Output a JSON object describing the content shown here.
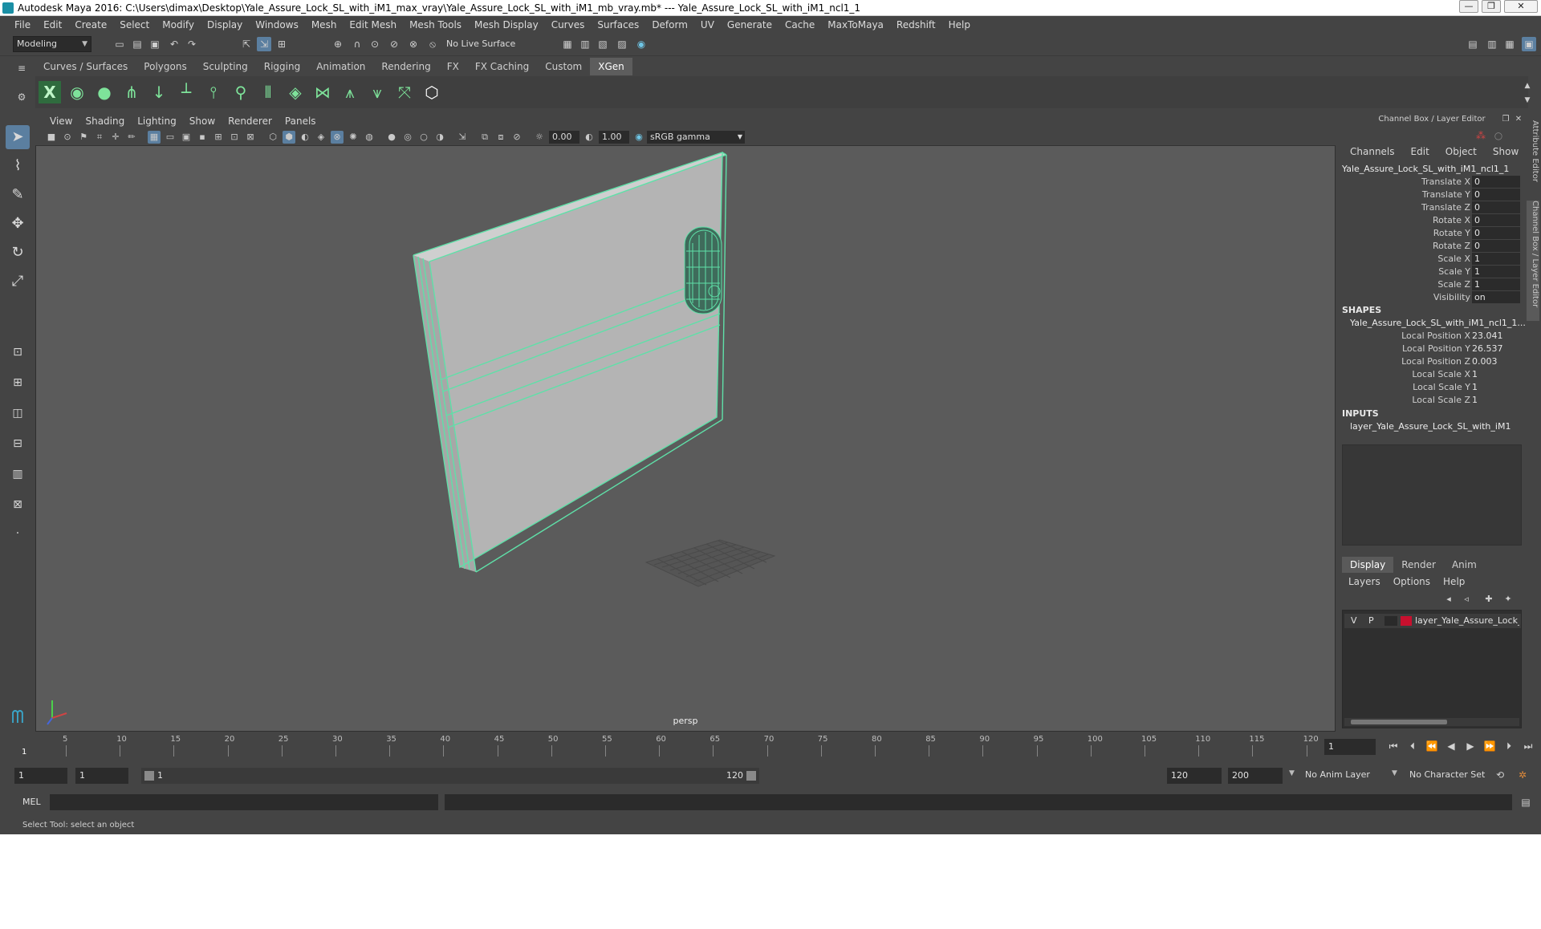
{
  "titlebar": {
    "title": "Autodesk Maya 2016: C:\\Users\\dimax\\Desktop\\Yale_Assure_Lock_SL_with_iM1_max_vray\\Yale_Assure_Lock_SL_with_iM1_mb_vray.mb*   ---   Yale_Assure_Lock_SL_with_iM1_ncl1_1",
    "minimize": "—",
    "maximize": "❐",
    "close": "✕"
  },
  "menubar": [
    "File",
    "Edit",
    "Create",
    "Select",
    "Modify",
    "Display",
    "Windows",
    "Mesh",
    "Edit Mesh",
    "Mesh Tools",
    "Mesh Display",
    "Curves",
    "Surfaces",
    "Deform",
    "UV",
    "Generate",
    "Cache",
    "MaxToMaya",
    "Redshift",
    "Help"
  ],
  "statusline": {
    "mode": "Modeling",
    "live_surface": "No Live Surface"
  },
  "shelf_tabs": [
    {
      "label": "Curves / Surfaces",
      "active": false
    },
    {
      "label": "Polygons",
      "active": false
    },
    {
      "label": "Sculpting",
      "active": false
    },
    {
      "label": "Rigging",
      "active": false
    },
    {
      "label": "Animation",
      "active": false
    },
    {
      "label": "Rendering",
      "active": false
    },
    {
      "label": "FX",
      "active": false
    },
    {
      "label": "FX Caching",
      "active": false
    },
    {
      "label": "Custom",
      "active": false
    },
    {
      "label": "XGen",
      "active": true
    }
  ],
  "panel_menu": [
    "View",
    "Shading",
    "Lighting",
    "Show",
    "Renderer",
    "Panels"
  ],
  "panel_tools": {
    "exposure": "0.00",
    "gamma": "1.00",
    "color_space": "sRGB gamma"
  },
  "viewport": {
    "camera_label": "persp"
  },
  "channel_box": {
    "panel_title": "Channel Box / Layer Editor",
    "menus": [
      "Channels",
      "Edit",
      "Object",
      "Show"
    ],
    "object_name": "Yale_Assure_Lock_SL_with_iM1_ncl1_1",
    "attributes": [
      {
        "name": "Translate X",
        "value": "0"
      },
      {
        "name": "Translate Y",
        "value": "0"
      },
      {
        "name": "Translate Z",
        "value": "0"
      },
      {
        "name": "Rotate X",
        "value": "0"
      },
      {
        "name": "Rotate Y",
        "value": "0"
      },
      {
        "name": "Rotate Z",
        "value": "0"
      },
      {
        "name": "Scale X",
        "value": "1"
      },
      {
        "name": "Scale Y",
        "value": "1"
      },
      {
        "name": "Scale Z",
        "value": "1"
      },
      {
        "name": "Visibility",
        "value": "on"
      }
    ],
    "shapes_header": "SHAPES",
    "shape_name": "Yale_Assure_Lock_SL_with_iM1_ncl1_1...",
    "shape_attributes": [
      {
        "name": "Local Position X",
        "value": "23.041"
      },
      {
        "name": "Local Position Y",
        "value": "26.537"
      },
      {
        "name": "Local Position Z",
        "value": "0.003"
      },
      {
        "name": "Local Scale X",
        "value": "1"
      },
      {
        "name": "Local Scale Y",
        "value": "1"
      },
      {
        "name": "Local Scale Z",
        "value": "1"
      }
    ],
    "inputs_header": "INPUTS",
    "input_name": "layer_Yale_Assure_Lock_SL_with_iM1"
  },
  "side_tabs": {
    "attribute_editor": "Attribute Editor",
    "channel_box": "Channel Box / Layer Editor"
  },
  "layer_editor": {
    "tabs": [
      {
        "label": "Display",
        "active": true
      },
      {
        "label": "Render",
        "active": false
      },
      {
        "label": "Anim",
        "active": false
      }
    ],
    "menus": [
      "Layers",
      "Options",
      "Help"
    ],
    "layer": {
      "v": "V",
      "p": "P",
      "name": "layer_Yale_Assure_Lock_S",
      "color": "#c8102e"
    }
  },
  "timeline": {
    "ticks": [
      "5",
      "10",
      "15",
      "20",
      "25",
      "30",
      "35",
      "40",
      "45",
      "50",
      "55",
      "60",
      "65",
      "70",
      "75",
      "80",
      "85",
      "90",
      "95",
      "100",
      "105",
      "110",
      "115",
      "120"
    ],
    "start_marker": "1",
    "current_frame": "1"
  },
  "range": {
    "start": "1",
    "anim_start": "1",
    "slider_start": "1",
    "slider_end": "120",
    "end": "120",
    "anim_end": "200",
    "anim_layer": "No Anim Layer",
    "character_set": "No Character Set"
  },
  "commandline": {
    "lang": "MEL"
  },
  "helpline": {
    "text": "Select Tool: select an object"
  },
  "colors": {
    "wireframe": "#5fe0a8",
    "selection_tool": "#5b7fa0"
  }
}
